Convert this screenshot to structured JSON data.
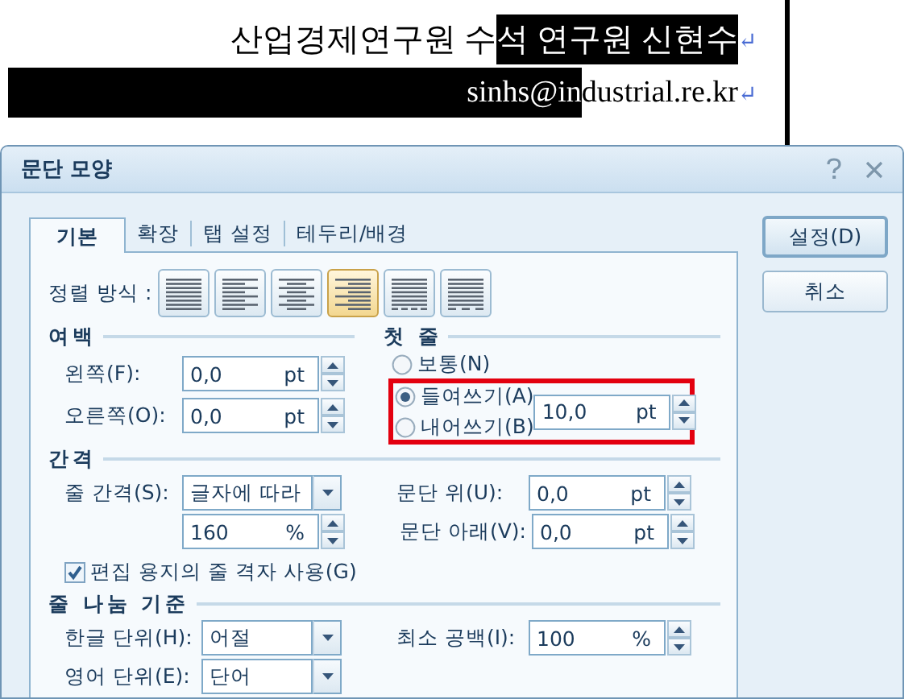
{
  "document": {
    "lines": [
      {
        "segments": [
          {
            "text": "산업경제연구원 수",
            "selected": false
          },
          {
            "text": "석 연구원 신현수",
            "selected": true
          }
        ],
        "end_mark": "↵"
      },
      {
        "segments": [
          {
            "text": "sinhs@in",
            "selected": true
          },
          {
            "text": "dustrial.re.kr",
            "selected": false
          }
        ],
        "end_mark": "↵",
        "lead_selected": true
      }
    ]
  },
  "window": {
    "title": "문단 모양"
  },
  "tabs": [
    {
      "label": "기본",
      "selected": true
    },
    {
      "label": "확장",
      "selected": false
    },
    {
      "label": "탭 설정",
      "selected": false
    },
    {
      "label": "테두리/배경",
      "selected": false
    }
  ],
  "buttons": [
    {
      "label": "설정(D)",
      "default": true
    },
    {
      "label": "취소",
      "default": false
    }
  ],
  "alignment": {
    "label": "정렬 방식 :",
    "options": [
      {
        "kind": "justify",
        "selected": false
      },
      {
        "kind": "left",
        "selected": false
      },
      {
        "kind": "center",
        "selected": false
      },
      {
        "kind": "right",
        "selected": true
      },
      {
        "kind": "distribute",
        "selected": false
      },
      {
        "kind": "divide",
        "selected": false
      }
    ]
  },
  "margins": {
    "heading": "여백",
    "fields": [
      {
        "label": "왼쪽(F):",
        "value": "0,0",
        "unit": "pt"
      },
      {
        "label": "오른쪽(O):",
        "value": "0,0",
        "unit": "pt"
      }
    ]
  },
  "first_line": {
    "heading": "첫 줄",
    "highlighted": true,
    "options": [
      {
        "label": "보통(N)",
        "selected": false
      },
      {
        "label": "들여쓰기(A)",
        "selected": true
      },
      {
        "label": "내어쓰기(B)",
        "selected": false
      }
    ],
    "value": "10,0",
    "unit": "pt"
  },
  "spacing": {
    "heading": "간격",
    "line_spacing": {
      "label": "줄 간격(S):",
      "value": "글자에 따라"
    },
    "line_spacing_amount": {
      "value": "160",
      "unit": "%"
    },
    "above": {
      "label": "문단 위(U):",
      "value": "0,0",
      "unit": "pt"
    },
    "below": {
      "label": "문단 아래(V):",
      "value": "0,0",
      "unit": "pt"
    },
    "grid_checkbox": {
      "label": "편집 용지의 줄 격자 사용(G)",
      "checked": true
    }
  },
  "line_break": {
    "heading": "줄 나눔 기준",
    "korean": {
      "label": "한글 단위(H):",
      "value": "어절"
    },
    "min_space": {
      "label": "최소 공백(I):",
      "value": "100",
      "unit": "%"
    },
    "english": {
      "label": "영어 단위(E):",
      "value": "단어"
    }
  }
}
